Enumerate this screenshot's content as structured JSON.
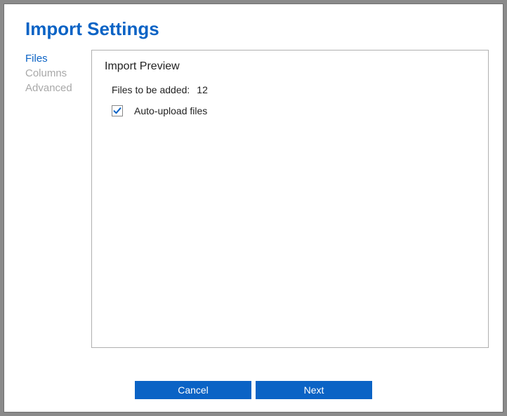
{
  "title": "Import Settings",
  "sidebar": {
    "items": [
      {
        "label": "Files",
        "active": true
      },
      {
        "label": "Columns",
        "active": false
      },
      {
        "label": "Advanced",
        "active": false
      }
    ]
  },
  "main": {
    "heading": "Import Preview",
    "files_label": "Files to be added:",
    "files_count": "12",
    "auto_upload_label": "Auto-upload files",
    "auto_upload_checked": true
  },
  "footer": {
    "cancel_label": "Cancel",
    "next_label": "Next"
  }
}
